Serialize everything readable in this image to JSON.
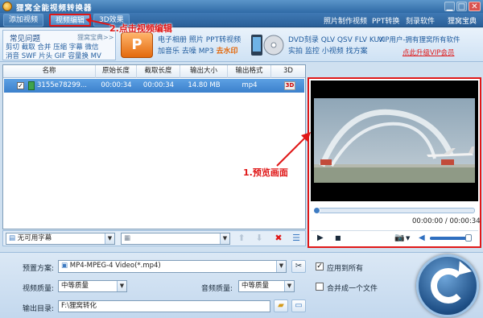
{
  "window": {
    "title": "狸窝全能视频转换器",
    "controls": {
      "minimize": "▁",
      "maximize": "□",
      "close": "✕"
    }
  },
  "menubar": {
    "tabs": [
      "添加视频",
      "视频编辑",
      "3D效果"
    ],
    "links": [
      "照片制作视频",
      "PPT转换",
      "刻录软件",
      "狸窝宝典"
    ]
  },
  "annotations": {
    "step2": "2.点击视频编辑",
    "step1": "1.预览画面",
    "color": "#e01818"
  },
  "faq": {
    "title": "常见问题",
    "more": "狸窝宝典>>",
    "line1": "剪切  截取  合并  压缩  字幕  微信",
    "line2": "消音  SWF  片头  GIF  容量换  MV"
  },
  "features": {
    "ppt_icon_text": "P",
    "group1_line1": "电子相册  照片  PPT转视频",
    "group1_line2": "加音乐  去噪  MP3",
    "group1_emphasis": "去水印",
    "group2_line1": "DVD刻录  QLV  QSV  FLV  KUX",
    "group2_line2": "实拍  监控  小视频  找方案"
  },
  "vip": {
    "line1": "VIP用户-拥有狸窝所有软件",
    "line2": "点此升级VIP会员"
  },
  "filelist": {
    "columns": [
      "名称",
      "原始长度",
      "截取长度",
      "输出大小",
      "输出格式",
      "3D"
    ],
    "rows": [
      {
        "checked": "✓",
        "name": "3155e78299...",
        "original_length": "00:00:34",
        "cut_length": "00:00:34",
        "output_size": "14.80 MB",
        "format": "mp4",
        "threed": "3D"
      }
    ]
  },
  "list_toolbar": {
    "subtitle": "无可用字幕",
    "audio_track": ""
  },
  "preview": {
    "time": "00:00:00 / 00:00:34",
    "progress": 0
  },
  "settings": {
    "preset_label": "预置方案:",
    "preset_value": "MP4-MPEG-4 Video(*.mp4)",
    "apply_all_label": "应用到所有",
    "apply_all_checked": "✓",
    "video_quality_label": "视频质量:",
    "video_quality_value": "中等质量",
    "audio_quality_label": "音频质量:",
    "audio_quality_value": "中等质量",
    "merge_label": "合并成一个文件",
    "output_dir_label": "输出目录:",
    "output_dir_value": "F:\\狸窝转化"
  }
}
